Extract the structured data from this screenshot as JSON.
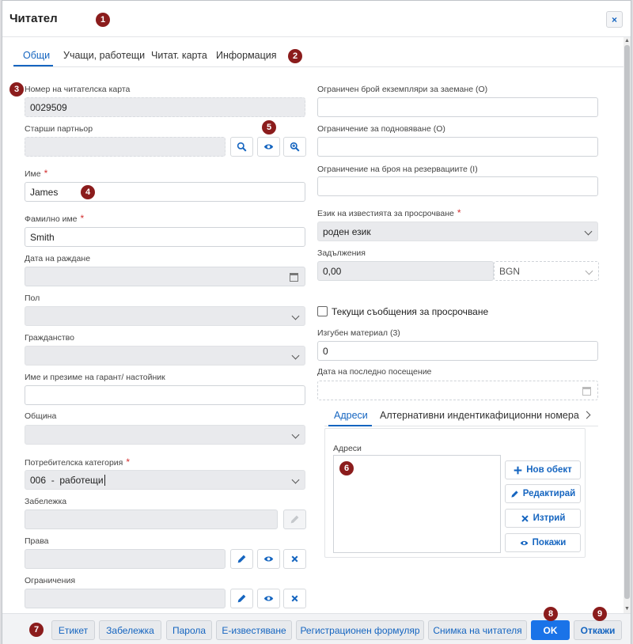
{
  "dialog": {
    "title": "Читател",
    "close_label": "×"
  },
  "tabs": [
    "Общи",
    "Учащи, работещи",
    "Читат. карта",
    "Информация"
  ],
  "left": {
    "card_number": {
      "label": "Номер на читателска карта",
      "value": "0029509"
    },
    "senior_partner": {
      "label": "Старши партньор",
      "value": ""
    },
    "first_name": {
      "label": "Име",
      "value": "James"
    },
    "last_name": {
      "label": "Фамилно име",
      "value": "Smith"
    },
    "birth_date": {
      "label": "Дата на раждане",
      "value": ""
    },
    "gender": {
      "label": "Пол",
      "value": ""
    },
    "citizenship": {
      "label": "Гражданство",
      "value": ""
    },
    "guarantor": {
      "label": "Име и презиме на гарант/ настойник",
      "value": ""
    },
    "municipality": {
      "label": "Община",
      "value": ""
    },
    "user_category": {
      "label": "Потребителска категория",
      "value": "006  -  работещи"
    },
    "note": {
      "label": "Забележка",
      "value": ""
    },
    "rights": {
      "label": "Права",
      "value": ""
    },
    "restrictions": {
      "label": "Ограничения",
      "value": ""
    }
  },
  "right": {
    "max_copies": {
      "label": "Ограничен брой екземпляри за заемане (О)",
      "value": ""
    },
    "renewal_limit": {
      "label": "Ограничение за подновяване (О)",
      "value": ""
    },
    "reservation_limit": {
      "label": "Ограничение на броя на резервациите (I)",
      "value": ""
    },
    "overdue_language": {
      "label": "Език на известията за просрочване",
      "value": "роден език"
    },
    "debts": {
      "label": "Задължения",
      "value": "0,00",
      "currency": "BGN"
    },
    "overdue_messages": {
      "label": "Текущи съобщения за просрочване"
    },
    "lost_material": {
      "label": "Изгубен материал (3)",
      "value": "0"
    },
    "last_visit": {
      "label": "Дата на последно посещение",
      "value": ""
    }
  },
  "subtabs": [
    "Адреси",
    "Алтернативни индентикафиционни номера"
  ],
  "addresses": {
    "label": "Адреси",
    "buttons": [
      "Нов обект",
      "Редактирай",
      "Изтрий",
      "Покажи"
    ]
  },
  "footer": {
    "buttons": [
      "Етикет",
      "Забележка",
      "Парола",
      "Е-известяване",
      "Регистрационен формуляр",
      "Снимка на читателя"
    ],
    "ok": "OK",
    "cancel": "Откажи"
  },
  "badges": [
    "1",
    "2",
    "3",
    "4",
    "5",
    "6",
    "7",
    "8",
    "9"
  ],
  "colors": {
    "accent": "#1565c0",
    "primary_button": "#1a73e8",
    "badge": "#8b1c1c",
    "required": "#d32f2f"
  },
  "icons": [
    "close-icon",
    "search-icon",
    "eye-icon",
    "zoom-in-icon",
    "calendar-icon",
    "chevron-down-icon",
    "pencil-icon",
    "times-icon",
    "plus-icon",
    "chevron-right-icon"
  ]
}
